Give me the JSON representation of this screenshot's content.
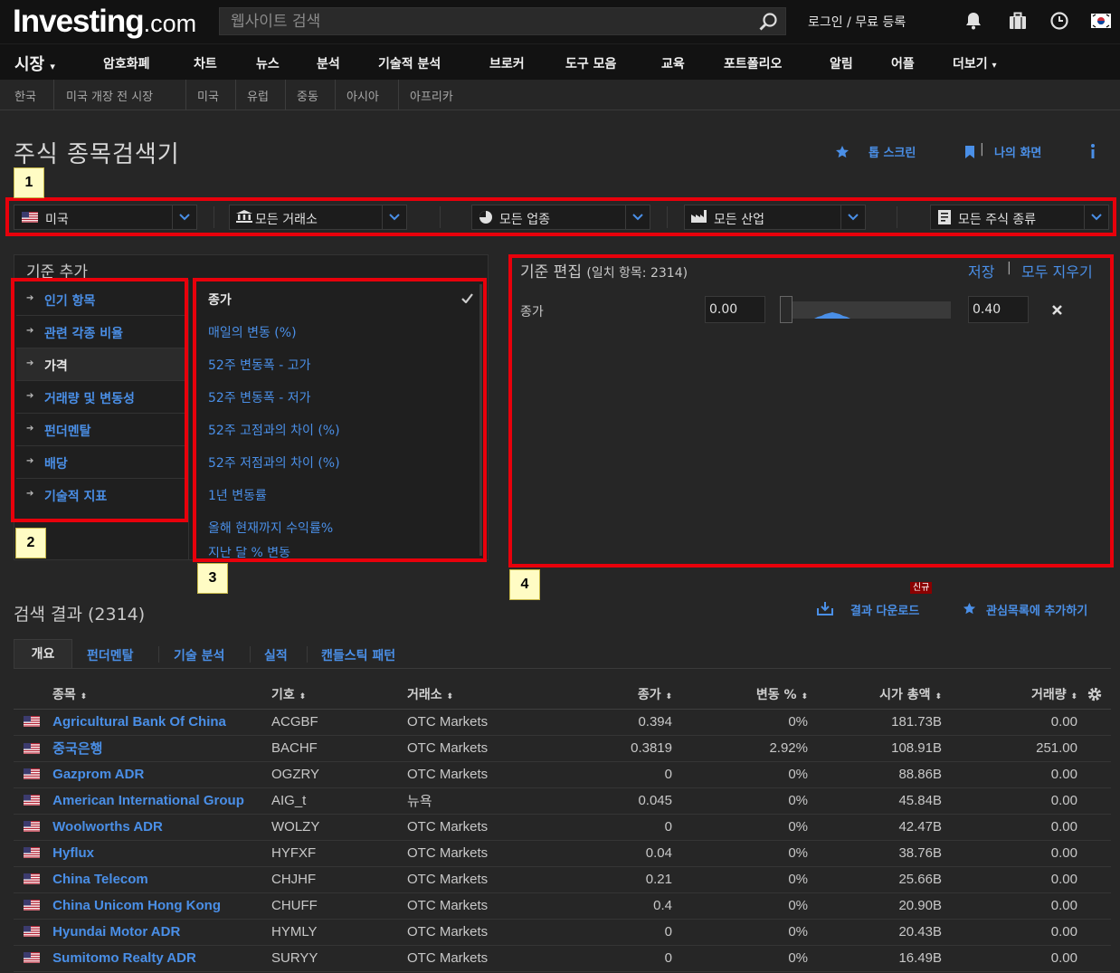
{
  "header": {
    "logo_main": "Investing",
    "logo_suffix": ".com",
    "search_placeholder": "웹사이트 검색",
    "login_label": "로그인 / 무료 등록"
  },
  "nav": {
    "market": "시장",
    "items": [
      "암호화폐",
      "차트",
      "뉴스",
      "분석",
      "기술적 분석",
      "브로커",
      "도구 모음",
      "교육",
      "포트폴리오",
      "알림",
      "어플"
    ],
    "more": "더보기"
  },
  "subnav": [
    "한국",
    "미국 개장 전 시장",
    "미국",
    "유럽",
    "중동",
    "아시아",
    "아프리카"
  ],
  "page": {
    "title": "주식 종목검색기",
    "top_screen": "톱 스크린",
    "my_screen": "나의 화면"
  },
  "filters": {
    "country": "미국",
    "exchange": "모든 거래소",
    "sector": "모든 업종",
    "industry": "모든 산업",
    "stock_type": "모든 주식 종류"
  },
  "criteria": {
    "title": "기준 추가",
    "categories": [
      "인기 항목",
      "관련 각종 비율",
      "가격",
      "거래량 및 변동성",
      "펀더멘탈",
      "배당",
      "기술적 지표"
    ],
    "active_category": "가격",
    "items": [
      "종가",
      "매일의 변동 (%)",
      "52주 변동폭 - 고가",
      "52주 변동폭 - 저가",
      "52주 고점과의 차이 (%)",
      "52주 저점과의 차이 (%)",
      "1년 변동률",
      "올해 현재까지 수익률%",
      "지난 달 % 변동"
    ],
    "selected_item": "종가"
  },
  "edit": {
    "title": "기준 편집",
    "match_label": "(일치 항목: 2314)",
    "save": "저장",
    "clear_all": "모두 지우기",
    "row_label": "종가",
    "min_value": "0.00",
    "max_value": "0.40"
  },
  "annotations": [
    "1",
    "2",
    "3",
    "4"
  ],
  "results": {
    "title": "검색 결과 (2314)",
    "new_badge": "신규",
    "download": "결과 다운로드",
    "add_watchlist": "관심목록에 추가하기",
    "tabs": [
      "개요",
      "펀더멘탈",
      "기술 분석",
      "실적",
      "캔들스틱 패턴"
    ],
    "columns": [
      "종목",
      "기호",
      "거래소",
      "종가",
      "변동 %",
      "시가 총액",
      "거래량"
    ],
    "rows": [
      {
        "name": "Agricultural Bank Of China",
        "symbol": "ACGBF",
        "exchange": "OTC Markets",
        "price": "0.394",
        "change": "0%",
        "cap": "181.73B",
        "volume": "0.00"
      },
      {
        "name": "중국은행",
        "symbol": "BACHF",
        "exchange": "OTC Markets",
        "price": "0.3819",
        "change": "2.92%",
        "cap": "108.91B",
        "volume": "251.00"
      },
      {
        "name": "Gazprom ADR",
        "symbol": "OGZRY",
        "exchange": "OTC Markets",
        "price": "0",
        "change": "0%",
        "cap": "88.86B",
        "volume": "0.00"
      },
      {
        "name": "American International Group",
        "symbol": "AIG_t",
        "exchange": "뉴욕",
        "price": "0.045",
        "change": "0%",
        "cap": "45.84B",
        "volume": "0.00"
      },
      {
        "name": "Woolworths ADR",
        "symbol": "WOLZY",
        "exchange": "OTC Markets",
        "price": "0",
        "change": "0%",
        "cap": "42.47B",
        "volume": "0.00"
      },
      {
        "name": "Hyflux",
        "symbol": "HYFXF",
        "exchange": "OTC Markets",
        "price": "0.04",
        "change": "0%",
        "cap": "38.76B",
        "volume": "0.00"
      },
      {
        "name": "China Telecom",
        "symbol": "CHJHF",
        "exchange": "OTC Markets",
        "price": "0.21",
        "change": "0%",
        "cap": "25.66B",
        "volume": "0.00"
      },
      {
        "name": "China Unicom Hong Kong",
        "symbol": "CHUFF",
        "exchange": "OTC Markets",
        "price": "0.4",
        "change": "0%",
        "cap": "20.90B",
        "volume": "0.00"
      },
      {
        "name": "Hyundai Motor ADR",
        "symbol": "HYMLY",
        "exchange": "OTC Markets",
        "price": "0",
        "change": "0%",
        "cap": "20.43B",
        "volume": "0.00"
      },
      {
        "name": "Sumitomo Realty ADR",
        "symbol": "SURYY",
        "exchange": "OTC Markets",
        "price": "0",
        "change": "0%",
        "cap": "16.49B",
        "volume": "0.00"
      }
    ]
  },
  "colors": {
    "accent": "#4a8fe7",
    "annotation_red": "#e8000b",
    "background": "#262626"
  }
}
